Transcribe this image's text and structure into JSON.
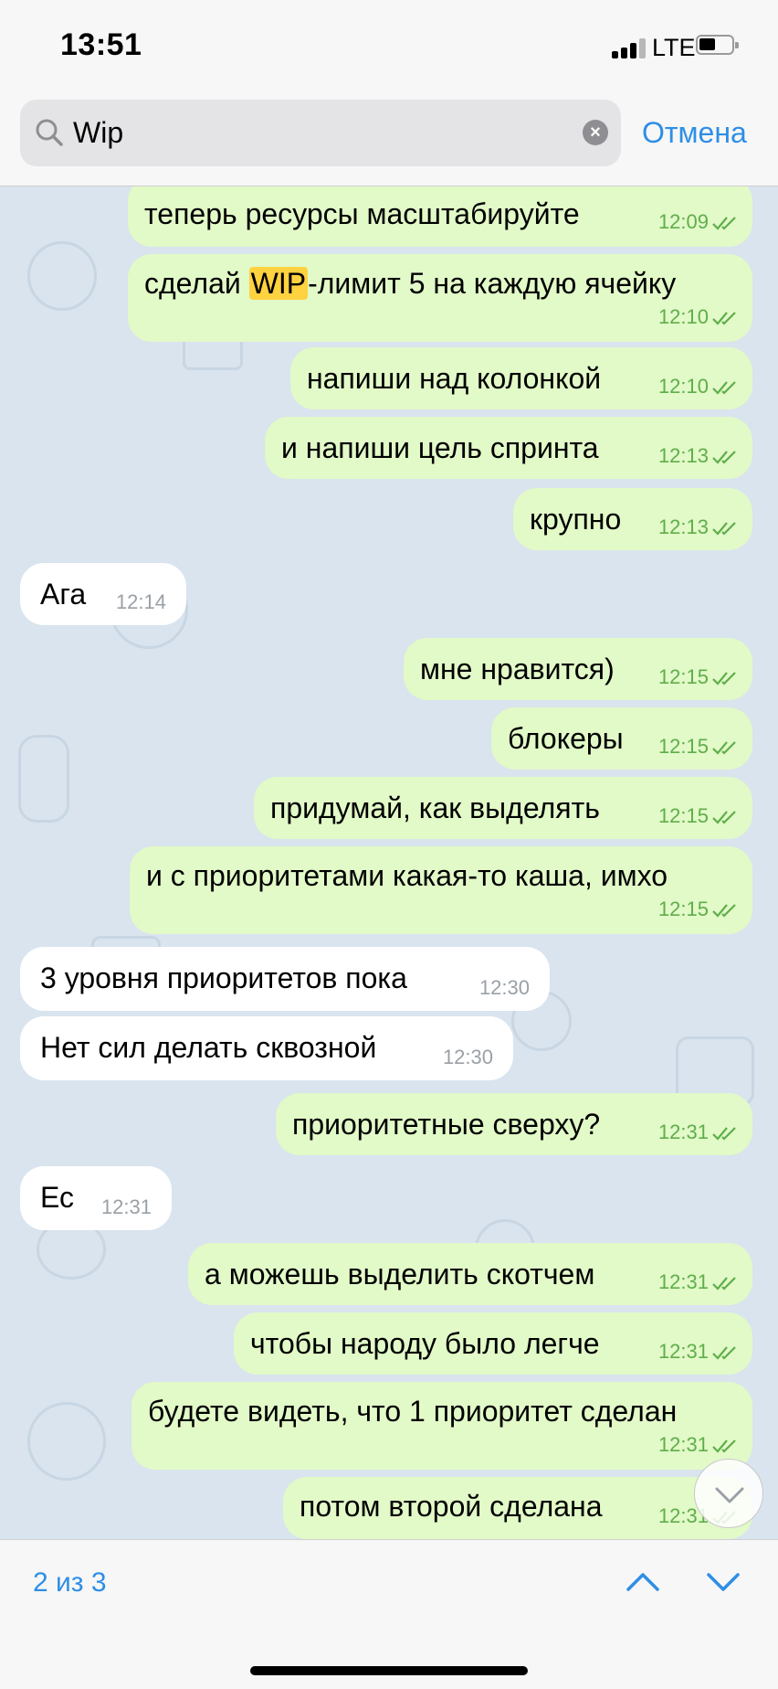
{
  "status_bar": {
    "time": "13:51",
    "network": "LTE"
  },
  "search": {
    "query": "Wip",
    "cancel_label": "Отмена"
  },
  "messages": [
    {
      "dir": "out",
      "text": "теперь ресурсы масштабируйте",
      "time": "12:09"
    },
    {
      "dir": "out",
      "text_before": "сделай ",
      "highlight": "WIP",
      "text_after": "-лимит 5 на каждую ячейку",
      "time": "12:10"
    },
    {
      "dir": "out",
      "text": "напиши над колонкой",
      "time": "12:10"
    },
    {
      "dir": "out",
      "text": "и напиши цель спринта",
      "time": "12:13"
    },
    {
      "dir": "out",
      "text": "крупно",
      "time": "12:13"
    },
    {
      "dir": "in",
      "text": "Ага",
      "time": "12:14"
    },
    {
      "dir": "out",
      "text": "мне нравится)",
      "time": "12:15"
    },
    {
      "dir": "out",
      "text": "блокеры",
      "time": "12:15"
    },
    {
      "dir": "out",
      "text": "придумай, как выделять",
      "time": "12:15"
    },
    {
      "dir": "out",
      "text": "и с приоритетами какая-то каша, имхо",
      "time": "12:15"
    },
    {
      "dir": "in",
      "text": "3 уровня приоритетов пока",
      "time": "12:30"
    },
    {
      "dir": "in",
      "text": "Нет сил делать сквозной",
      "time": "12:30"
    },
    {
      "dir": "out",
      "text": "приоритетные сверху?",
      "time": "12:31"
    },
    {
      "dir": "in",
      "text": "Ес",
      "time": "12:31"
    },
    {
      "dir": "out",
      "text": "а можешь выделить скотчем",
      "time": "12:31"
    },
    {
      "dir": "out",
      "text": "чтобы народу было легче",
      "time": "12:31"
    },
    {
      "dir": "out",
      "text": "будете видеть, что 1 приоритет сделан",
      "time": "12:31"
    },
    {
      "dir": "out",
      "text": "потом второй сделана",
      "time": "12:31"
    }
  ],
  "search_nav": {
    "result_count": "2 из 3"
  },
  "colors": {
    "accent": "#2e8ee6",
    "outgoing_bubble": "#e2f9c8",
    "incoming_bubble": "#ffffff",
    "highlight": "#ffd23f",
    "chat_background": "#d9e4ee"
  },
  "icons": {
    "search": "search-icon",
    "clear": "clear-icon",
    "scroll_down": "chevron-down-icon",
    "prev": "chevron-up-icon",
    "next": "chevron-down-icon",
    "read": "double-check-icon"
  }
}
